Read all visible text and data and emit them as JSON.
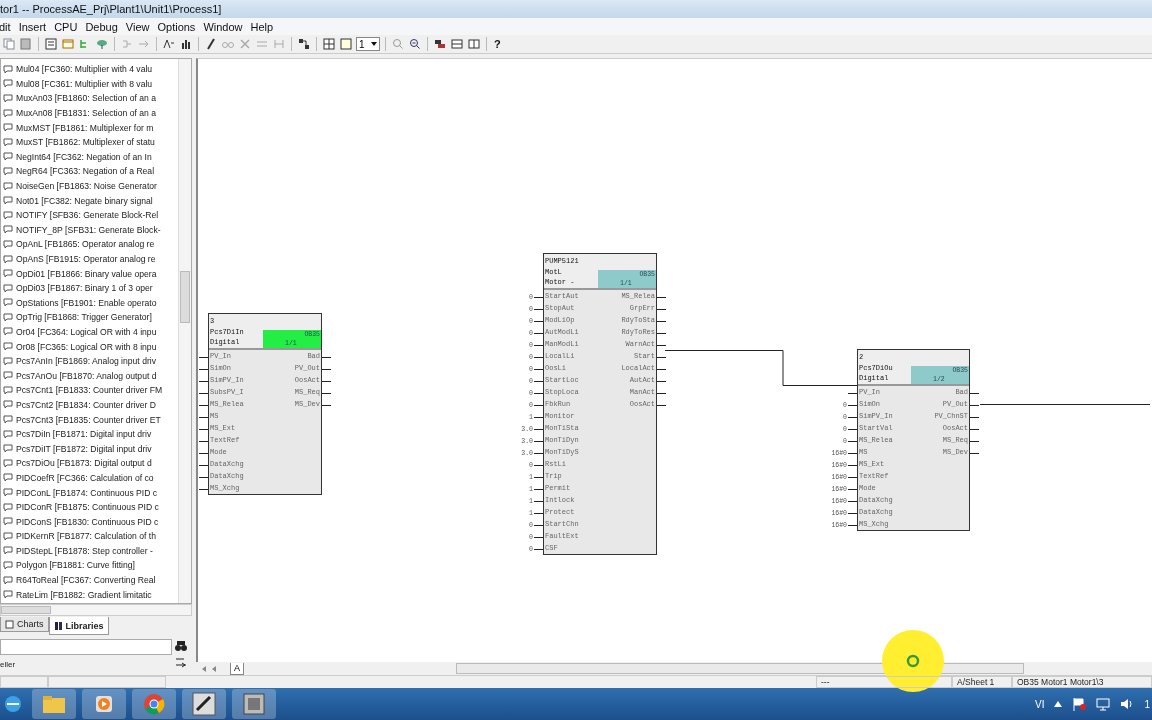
{
  "window": {
    "title": "tor1 -- ProcessAE_Prj\\Plant1\\Unit1\\Process1]"
  },
  "menu": [
    "dit",
    "Insert",
    "CPU",
    "Debug",
    "View",
    "Options",
    "Window",
    "Help"
  ],
  "toolbar": {
    "page_select": "1",
    "help": "?"
  },
  "library_tree": {
    "items": [
      "Mul04  [FC360: Multiplier with 4 valu",
      "Mul08  [FC361: Multiplier with 8 valu",
      "MuxAn03  [FB1860: Selection of an a",
      "MuxAn08  [FB1831: Selection of an a",
      "MuxMST  [FB1861: Multiplexer for m",
      "MuxST  [FB1862: Multiplexer of statu",
      "NegInt64  [FC362: Negation of an In",
      "NegR64  [FC363: Negation of a Real",
      "NoiseGen  [FB1863: Noise Generator",
      "Not01  [FC382: Negate binary signal",
      "NOTIFY  [SFB36: Generate Block-Rel",
      "NOTIFY_8P  [SFB31: Generate Block-",
      "OpAnL  [FB1865: Operator analog re",
      "OpAnS  [FB1915: Operator analog re",
      "OpDi01  [FB1866: Binary value opera",
      "OpDi03  [FB1867: Binary 1 of 3 oper",
      "OpStations  [FB1901: Enable operato",
      "OpTrig  [FB1868: Trigger Generator]",
      "Or04  [FC364: Logical OR with 4 inpu",
      "Or08  [FC365: Logical OR with 8 inpu",
      "Pcs7AnIn  [FB1869: Analog input driv",
      "Pcs7AnOu  [FB1870: Analog output d",
      "Pcs7Cnt1  [FB1833: Counter driver FM",
      "Pcs7Cnt2  [FB1834: Counter driver D",
      "Pcs7Cnt3  [FB1835: Counter driver ET",
      "Pcs7DiIn  [FB1871: Digital input driv",
      "Pcs7DiIT  [FB1872: Digital input driv",
      "Pcs7DiOu  [FB1873: Digital output d",
      "PIDCoefR  [FC366: Calculation of co",
      "PIDConL  [FB1874: Continuous PID c",
      "PIDConR  [FB1875: Continuous PID c",
      "PIDConS  [FB1830: Continuous PID c",
      "PIDKernR  [FB1877: Calculation of th",
      "PIDStepL  [FB1878: Step controller -",
      "Polygon  [FB1881: Curve fitting]",
      "R64ToReal  [FC367: Converting Real",
      "RateLim  [FB1882: Gradient limitatic"
    ]
  },
  "panel_tabs": [
    {
      "label": "Charts",
      "selected": false
    },
    {
      "label": "Libraries",
      "selected": true
    }
  ],
  "find_result": "eller",
  "chart": {
    "sheet_tab": "A",
    "blocks": [
      {
        "number": "3",
        "type": "Pcs7DiIn",
        "comment": "Digital",
        "task": "OB35",
        "sequence": "1/1",
        "color": "#22ee44",
        "inputs": [
          {
            "name": "PV_In"
          },
          {
            "name": "SimOn"
          },
          {
            "name": "SimPV_In"
          },
          {
            "name": "SubsPV_I"
          },
          {
            "name": "MS_Relea"
          },
          {
            "name": "MS"
          },
          {
            "name": "MS_Ext"
          },
          {
            "name": "TextRef"
          },
          {
            "name": "Mode"
          },
          {
            "name": "DataXchg"
          },
          {
            "name": "DataXchg"
          },
          {
            "name": "MS_Xchg"
          }
        ],
        "outputs": [
          "Bad",
          "PV_Out",
          "OosAct",
          "MS_Req",
          "MS_Dev"
        ]
      },
      {
        "number": "PUMP5121",
        "type": "MotL",
        "comment": "Motor -",
        "task": "OB35",
        "sequence": "1/1",
        "color": "#8ecaca",
        "inputs": [
          {
            "name": "StartAut",
            "value": "0"
          },
          {
            "name": "StopAut",
            "value": "0"
          },
          {
            "name": "ModLiOp",
            "value": "0"
          },
          {
            "name": "AutModLi",
            "value": "0"
          },
          {
            "name": "ManModLi",
            "value": "0"
          },
          {
            "name": "LocalLi",
            "value": "0"
          },
          {
            "name": "OosLi",
            "value": "0"
          },
          {
            "name": "StartLoc",
            "value": "0"
          },
          {
            "name": "StopLoca",
            "value": "0"
          },
          {
            "name": "FbkRun",
            "value": "0"
          },
          {
            "name": "Monitor",
            "value": "1"
          },
          {
            "name": "MonTiSta",
            "value": "3.0"
          },
          {
            "name": "MonTiDyn",
            "value": "3.0"
          },
          {
            "name": "MonTiDyS",
            "value": "3.0"
          },
          {
            "name": "RstLi",
            "value": "0"
          },
          {
            "name": "Trip",
            "value": "1"
          },
          {
            "name": "Permit",
            "value": "1"
          },
          {
            "name": "Intlock",
            "value": "1"
          },
          {
            "name": "Protect",
            "value": "1"
          },
          {
            "name": "StartChn",
            "value": "0"
          },
          {
            "name": "FaultExt",
            "value": "0"
          },
          {
            "name": "CSF",
            "value": "0"
          }
        ],
        "outputs": [
          "MS_Relea",
          "GrpErr",
          "RdyToSta",
          "RdyToRes",
          "WarnAct",
          "Start",
          "LocalAct",
          "AutAct",
          "ManAct",
          "OosAct"
        ]
      },
      {
        "number": "2",
        "type": "Pcs7DiOu",
        "comment": "Digital",
        "task": "OB35",
        "sequence": "1/2",
        "color": "#8ecaca",
        "inputs": [
          {
            "name": "PV_In"
          },
          {
            "name": "SimOn",
            "value": "0"
          },
          {
            "name": "SimPV_In",
            "value": "0"
          },
          {
            "name": "StartVal",
            "value": "0"
          },
          {
            "name": "MS_Relea",
            "value": "0"
          },
          {
            "name": "MS",
            "value": "16#0"
          },
          {
            "name": "MS_Ext",
            "value": "16#0"
          },
          {
            "name": "TextRef",
            "value": "16#0"
          },
          {
            "name": "Mode",
            "value": "16#0"
          },
          {
            "name": "DataXchg",
            "value": "16#0"
          },
          {
            "name": "DataXchg",
            "value": "16#0"
          },
          {
            "name": "MS_Xchg",
            "value": "16#0"
          }
        ],
        "outputs": [
          "Bad",
          "PV_Out",
          "PV_ChnST",
          "OosAct",
          "MS_Req",
          "MS_Dev"
        ]
      }
    ]
  },
  "status_bar": [
    "---",
    "A/Sheet 1",
    "OB35  Motor1  Motor1\\3"
  ],
  "taskbar": {
    "language": "VI",
    "clock": "1"
  }
}
